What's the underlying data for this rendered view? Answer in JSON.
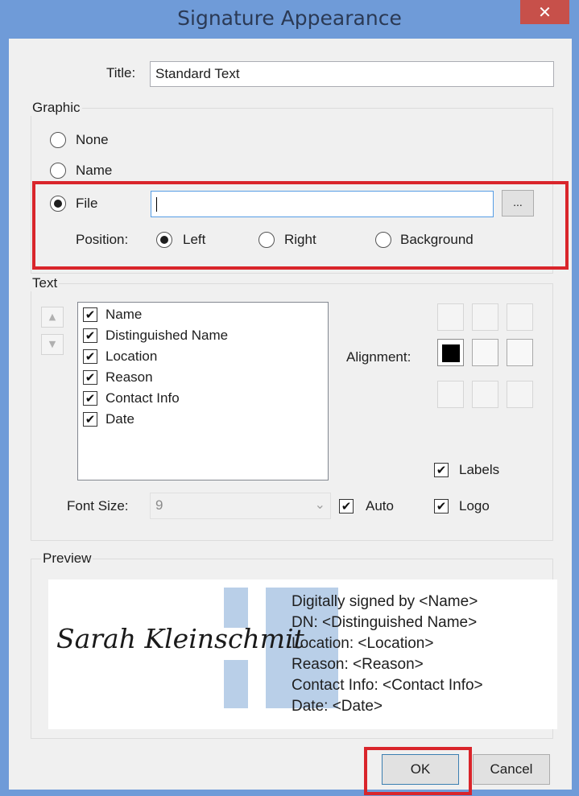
{
  "window": {
    "title": "Signature Appearance",
    "close_glyph": "✕"
  },
  "title_field": {
    "label": "Title:",
    "value": "Standard Text"
  },
  "graphic": {
    "group_label": "Graphic",
    "options": [
      {
        "label": "None",
        "selected": false
      },
      {
        "label": "Name",
        "selected": false
      },
      {
        "label": "File",
        "selected": true
      }
    ],
    "file_value": "",
    "browse_label": "...",
    "position_label": "Position:",
    "positions": [
      {
        "label": "Left",
        "selected": true
      },
      {
        "label": "Right",
        "selected": false
      },
      {
        "label": "Background",
        "selected": false
      }
    ]
  },
  "text": {
    "group_label": "Text",
    "move_up_icon": "▲",
    "move_down_icon": "▼",
    "items": [
      {
        "label": "Name",
        "checked": true
      },
      {
        "label": "Distinguished Name",
        "checked": true
      },
      {
        "label": "Location",
        "checked": true
      },
      {
        "label": "Reason",
        "checked": true
      },
      {
        "label": "Contact Info",
        "checked": true
      },
      {
        "label": "Date",
        "checked": true
      }
    ],
    "check_glyph": "✔",
    "alignment_label": "Alignment:",
    "alignment_selected": "middle-left",
    "labels_label": "Labels",
    "labels_checked": true,
    "logo_label": "Logo",
    "logo_checked": true,
    "font_size_label": "Font Size:",
    "font_size_value": "9",
    "dropdown_icon": "⌄",
    "auto_label": "Auto",
    "auto_checked": true
  },
  "preview": {
    "group_label": "Preview",
    "signature_text": "Sarah Kleinschmit",
    "logo_color": "#b9cfe8",
    "lines": [
      "Digitally signed by <Name>",
      "DN: <Distinguished Name>",
      "Location: <Location>",
      "Reason: <Reason>",
      "Contact Info: <Contact Info>",
      "Date: <Date>"
    ]
  },
  "buttons": {
    "ok": "OK",
    "cancel": "Cancel"
  },
  "highlight_color": "#d9252b"
}
